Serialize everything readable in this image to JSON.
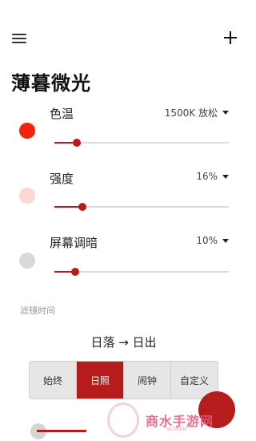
{
  "app": {
    "title": "薄暮微光"
  },
  "rows": [
    {
      "label": "色温",
      "value": "1500K 放松",
      "dot_color": "#f4230b",
      "level": 0.13
    },
    {
      "label": "强度",
      "value": "16%",
      "dot_color": "#fbd7d1",
      "level": 0.16
    },
    {
      "label": "屏幕调暗",
      "value": "10%",
      "dot_color": "#d9d9d9",
      "level": 0.12
    }
  ],
  "schedule": {
    "section_label": "滤镜时间",
    "title": "日落 → 日出",
    "modes": [
      {
        "label": "始终",
        "active": false
      },
      {
        "label": "日照",
        "active": true
      },
      {
        "label": "闹钟",
        "active": false
      },
      {
        "label": "自定义",
        "active": false
      }
    ]
  },
  "watermark": {
    "text": "商水手游网",
    "sub": "SLOGAN"
  },
  "colors": {
    "accent": "#b71c1c"
  }
}
